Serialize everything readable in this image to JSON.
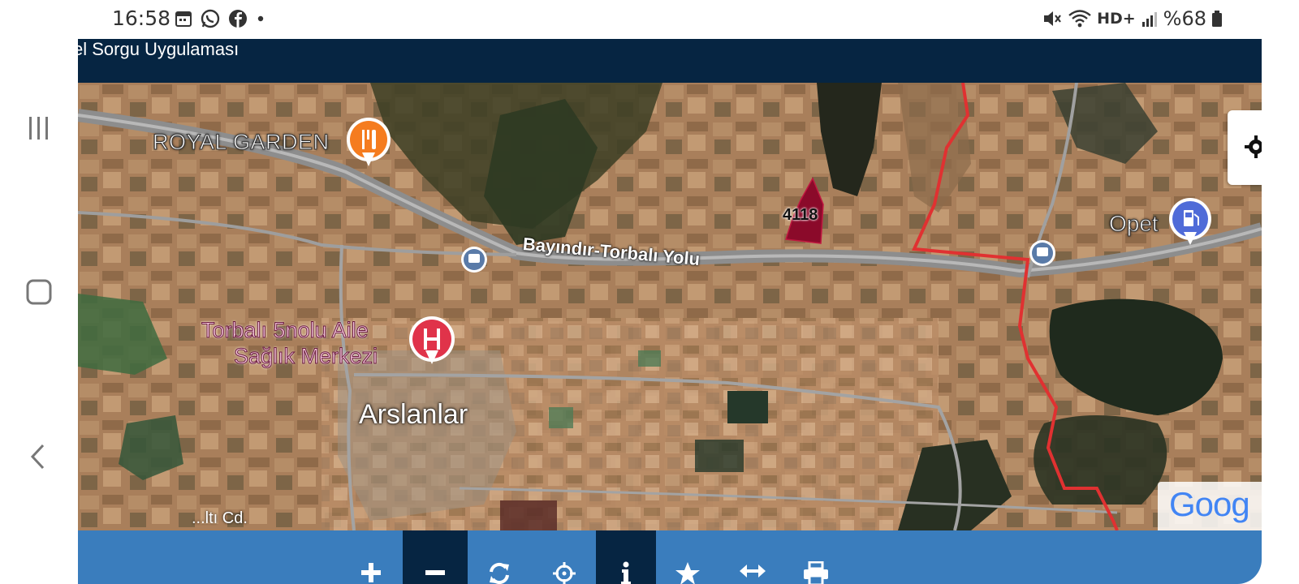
{
  "statusbar": {
    "time": "16:58",
    "battery": "%68",
    "network": "HD+"
  },
  "header": {
    "title": "el Sorgu Uygulaması"
  },
  "map": {
    "labels": {
      "royal_garden": "ROYAL GARDEN",
      "road": "Bayındır-Torbalı Yolu",
      "health_center_line1": "Torbalı 5nolu Aile",
      "health_center_line2": "Sağlık Merkezi",
      "town": "Arslanlar",
      "parcel": "4118",
      "opet": "Opet",
      "street_partial": "...ltı Cd.",
      "google": "Goog"
    },
    "colors": {
      "parcel": "#8b0a2a",
      "boundary": "#e03131",
      "hospital_pin": "#e0334a",
      "restaurant_pin": "#f57c1f",
      "fuel_pin": "#4f6bd8",
      "transit_pin": "#5a7ba8"
    }
  },
  "toolbar": {
    "items": [
      {
        "name": "zoom-in",
        "icon": "plus-icon",
        "active": false
      },
      {
        "name": "zoom-out",
        "icon": "minus-icon",
        "active": true
      },
      {
        "name": "refresh",
        "icon": "refresh-icon",
        "active": false
      },
      {
        "name": "locate",
        "icon": "crosshair-icon",
        "active": false
      },
      {
        "name": "info",
        "icon": "info-icon",
        "active": true
      },
      {
        "name": "favorite",
        "icon": "star-icon",
        "active": false
      },
      {
        "name": "measure",
        "icon": "arrows-horizontal-icon",
        "active": false
      },
      {
        "name": "print",
        "icon": "printer-icon",
        "active": false
      }
    ]
  }
}
